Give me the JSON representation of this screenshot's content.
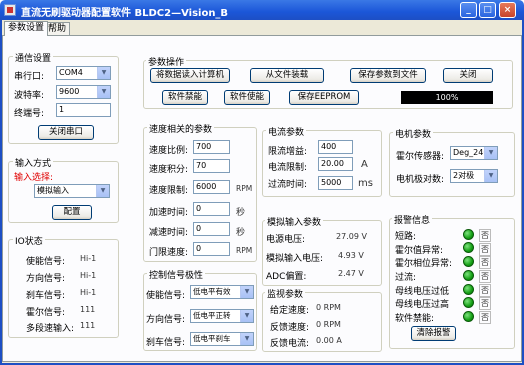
{
  "window": {
    "title": "直流无刷驱动器配置软件  BLDC2—Vision_B"
  },
  "tabs": [
    {
      "label": "参数设置"
    },
    {
      "label": "帮助"
    }
  ],
  "comm": {
    "title": "通信设置",
    "port_label": "串行口:",
    "port_value": "COM4",
    "baud_label": "波特率:",
    "baud_value": "9600",
    "addr_label": "终端号:",
    "addr_value": "1",
    "close_button": "关闭串口"
  },
  "input": {
    "title": "输入方式",
    "select_label": "输入选择:",
    "select_value": "模拟输入",
    "config_button": "配置"
  },
  "io": {
    "title": "IO状态",
    "rows": [
      {
        "label": "使能信号:",
        "value": "Hi-1"
      },
      {
        "label": "方向信号:",
        "value": "Hi-1"
      },
      {
        "label": "刹车信号:",
        "value": "Hi-1"
      },
      {
        "label": "霍尔信号:",
        "value": "111"
      },
      {
        "label": "多段速输入:",
        "value": "111"
      }
    ]
  },
  "ops": {
    "title": "参数操作",
    "btn_read": "将数据读入计算机",
    "btn_load": "从文件装载",
    "btn_save_file": "保存参数到文件",
    "btn_close": "关闭",
    "btn_disable": "软件禁能",
    "btn_enable": "软件使能",
    "btn_save_eeprom": "保存EEPROM",
    "progress_text": "100%",
    "progress": 1.0
  },
  "speed": {
    "title": "速度相关的参数",
    "rows": [
      {
        "label": "速度比例:",
        "value": "700",
        "unit": ""
      },
      {
        "label": "速度积分:",
        "value": "70",
        "unit": ""
      },
      {
        "label": "速度限制:",
        "value": "6000",
        "unit": "RPM"
      },
      {
        "label": "加速时间:",
        "value": "0",
        "unit": "秒"
      },
      {
        "label": "减速时间:",
        "value": "0",
        "unit": "秒"
      },
      {
        "label": "门限速度:",
        "value": "0",
        "unit": "RPM"
      }
    ]
  },
  "control": {
    "title": "控制信号极性",
    "rows": [
      {
        "label": "使能信号:",
        "value": "低电平有效"
      },
      {
        "label": "方向信号:",
        "value": "低电平正转"
      },
      {
        "label": "刹车信号:",
        "value": "低电平刹车"
      }
    ]
  },
  "current": {
    "title": "电流参数",
    "rows": [
      {
        "label": "限流增益:",
        "value": "400",
        "unit": ""
      },
      {
        "label": "电流限制:",
        "value": "20.00",
        "unit": "A"
      },
      {
        "label": "过流时间:",
        "value": "5000",
        "unit": "ms"
      }
    ]
  },
  "analog": {
    "title": "模拟输入参数",
    "rows": [
      {
        "label": "电源电压:",
        "value": "27.09 V"
      },
      {
        "label": "模拟输入电压:",
        "value": "4.93 V"
      },
      {
        "label": "ADC偏置:",
        "value": "2.47 V"
      }
    ]
  },
  "monitor": {
    "title": "监视参数",
    "rows": [
      {
        "label": "给定速度:",
        "value": "0 RPM"
      },
      {
        "label": "反馈速度:",
        "value": "0 RPM"
      },
      {
        "label": "反馈电流:",
        "value": "0.00 A"
      }
    ]
  },
  "motor": {
    "title": "电机参数",
    "hall_label": "霍尔传感器:",
    "hall_value": "Deg_240",
    "poles_label": "电机极对数:",
    "poles_value": "2对极"
  },
  "alarm": {
    "title": "报警信息",
    "rows": [
      {
        "label": "短路:",
        "value": "否"
      },
      {
        "label": "霍尔值异常:",
        "value": "否"
      },
      {
        "label": "霍尔相位异常:",
        "value": "否"
      },
      {
        "label": "过流:",
        "value": "否"
      },
      {
        "label": "母线电压过低",
        "value": "否"
      },
      {
        "label": "母线电压过高",
        "value": "否"
      },
      {
        "label": "软件禁能:",
        "value": "否"
      }
    ],
    "clear_button": "清除报警",
    "led_color": "#14a014"
  }
}
